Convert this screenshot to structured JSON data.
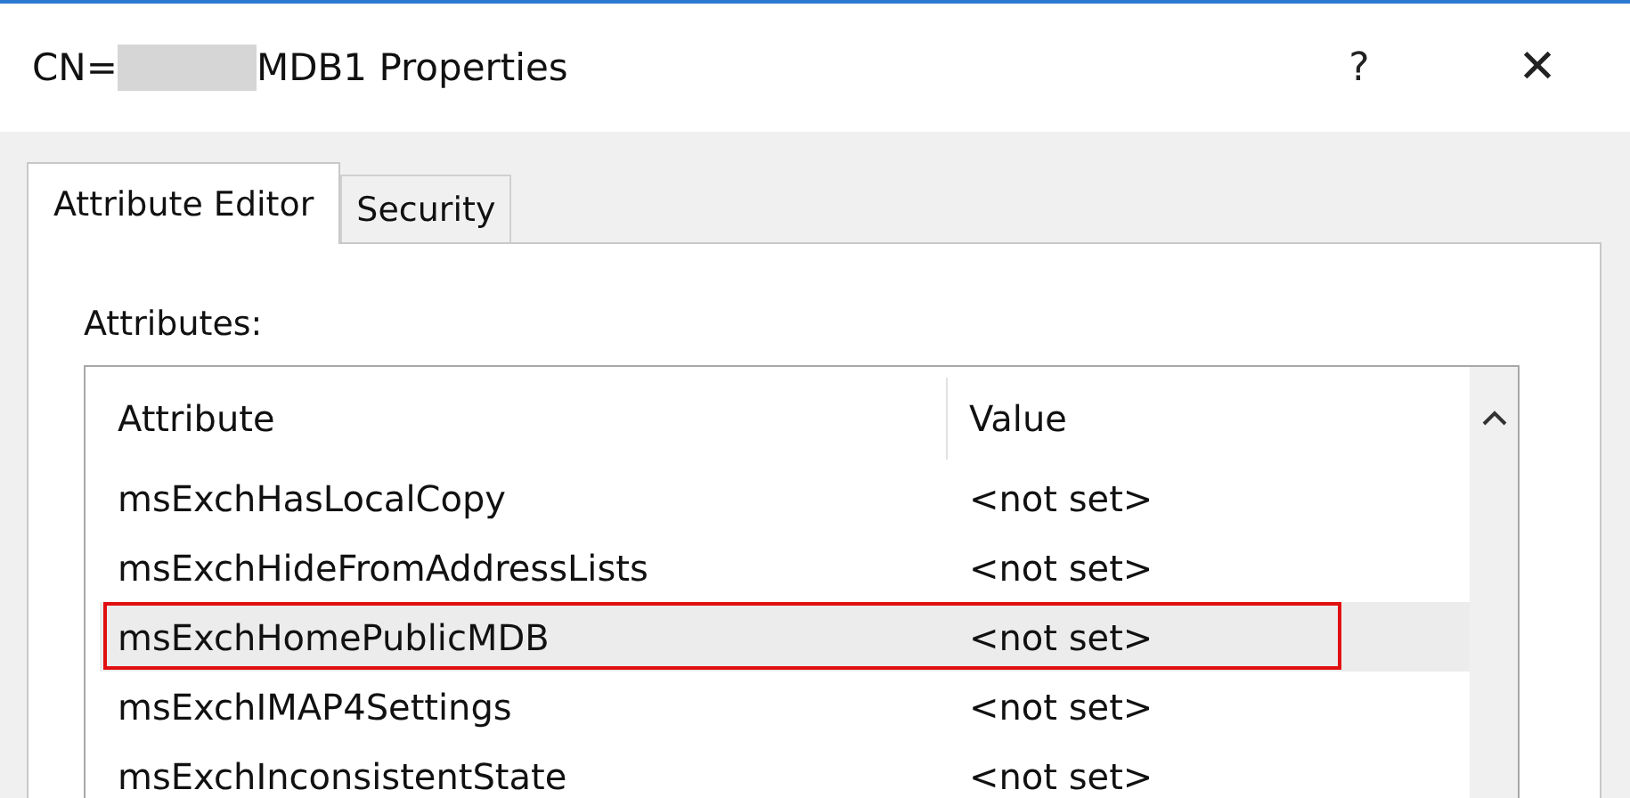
{
  "window": {
    "title_prefix": "CN=",
    "title_suffix": "MDB1 Properties",
    "help": "?",
    "close": "✕"
  },
  "tabs": [
    {
      "label": "Attribute Editor",
      "selected": true
    },
    {
      "label": "Security",
      "selected": false
    }
  ],
  "attributes_label": "Attributes:",
  "table": {
    "columns": [
      "Attribute",
      "Value"
    ],
    "rows": [
      {
        "attribute": "msExchHasLocalCopy",
        "value": "<not set>",
        "selected": false
      },
      {
        "attribute": "msExchHideFromAddressLists",
        "value": "<not set>",
        "selected": false
      },
      {
        "attribute": "msExchHomePublicMDB",
        "value": "<not set>",
        "selected": true
      },
      {
        "attribute": "msExchIMAP4Settings",
        "value": "<not set>",
        "selected": false
      },
      {
        "attribute": "msExchInconsistentState",
        "value": "<not set>",
        "selected": false
      }
    ]
  }
}
